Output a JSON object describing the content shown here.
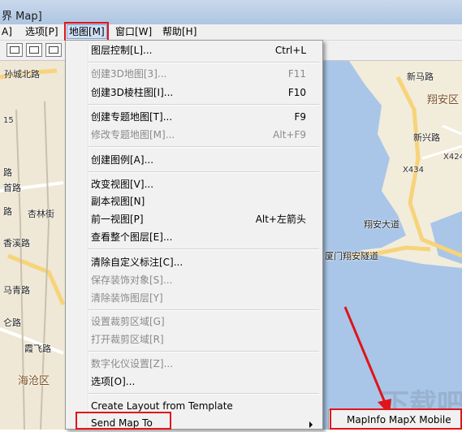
{
  "window": {
    "title": "界 Map]"
  },
  "menubar": [
    {
      "id": "menu-partial",
      "label": "A]"
    },
    {
      "id": "menu-options",
      "label": "选项[P]"
    },
    {
      "id": "menu-map",
      "label": "地图[M]"
    },
    {
      "id": "menu-window",
      "label": "窗口[W]"
    },
    {
      "id": "menu-help",
      "label": "帮助[H]"
    }
  ],
  "map_menu": {
    "items": [
      {
        "label": "图层控制[L]...",
        "shortcut": "Ctrl+L",
        "disabled": false
      },
      {
        "label": "创建3D地图[3]...",
        "shortcut": "F11",
        "disabled": true
      },
      {
        "label": "创建3D棱柱图[I]...",
        "shortcut": "F10",
        "disabled": false
      },
      {
        "label": "创建专题地图[T]...",
        "shortcut": "F9",
        "disabled": false
      },
      {
        "label": "修改专题地图[M]...",
        "shortcut": "Alt+F9",
        "disabled": true
      },
      {
        "label": "创建图例[A]...",
        "shortcut": "",
        "disabled": false
      },
      {
        "label": "改变视图[V]...",
        "shortcut": "",
        "disabled": false
      },
      {
        "label": "副本视图[N]",
        "shortcut": "",
        "disabled": false
      },
      {
        "label": "前一视图[P]",
        "shortcut": "Alt+左箭头",
        "disabled": false
      },
      {
        "label": "查看整个图层[E]...",
        "shortcut": "",
        "disabled": false
      },
      {
        "label": "清除自定义标注[C]...",
        "shortcut": "",
        "disabled": false
      },
      {
        "label": "保存装饰对象[S]...",
        "shortcut": "",
        "disabled": true
      },
      {
        "label": "清除装饰图层[Y]",
        "shortcut": "",
        "disabled": true
      },
      {
        "label": "设置裁剪区域[G]",
        "shortcut": "",
        "disabled": true
      },
      {
        "label": "打开裁剪区域[R]",
        "shortcut": "",
        "disabled": true
      },
      {
        "label": "数字化仪设置[Z]...",
        "shortcut": "",
        "disabled": true
      },
      {
        "label": "选项[O]...",
        "shortcut": "",
        "disabled": false
      },
      {
        "label": "Create Layout from Template",
        "shortcut": "",
        "disabled": false
      },
      {
        "label": "Send Map To",
        "shortcut": "",
        "disabled": false,
        "submenu": true
      }
    ]
  },
  "submenu": {
    "item": "MapInfo MapX Mobile"
  },
  "map_labels": {
    "l1": "孙城北路",
    "l2": "15",
    "l3": "路",
    "l4": "首路",
    "l5": "路",
    "l6": "杏林街",
    "l7": "香溪路",
    "l8": "马青路",
    "l9": "仑路",
    "l10": "霞飞路",
    "l11": "海沧区",
    "r1": "新马路",
    "r2": "翔安区",
    "r3": "新兴路",
    "r4": "X424",
    "r5": "X434",
    "r6": "翔安大道",
    "r7": "厦门翔安隧道"
  },
  "watermark": "下载吧"
}
